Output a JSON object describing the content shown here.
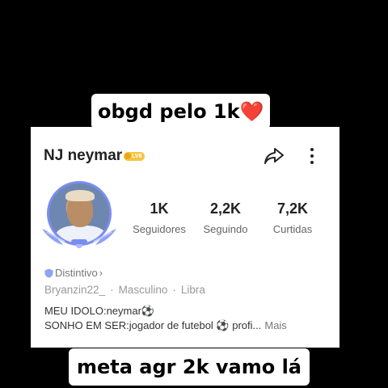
{
  "captions": {
    "top": "obgd pelo 1k",
    "top_emoji": "❤️",
    "bottom": "meta agr 2k vamo lá"
  },
  "profile": {
    "username": "NJ neymar",
    "level_badge": "LV6",
    "icons": {
      "share": "share-arrow-icon",
      "more": "more-vertical-icon",
      "badge": "shield-icon"
    },
    "stats": [
      {
        "value": "1K",
        "label": "Seguidores"
      },
      {
        "value": "2,2K",
        "label": "Seguindo"
      },
      {
        "value": "7,2K",
        "label": "Curtidas"
      }
    ],
    "distintivo": "Distintivo",
    "distintivo_chevron": "›",
    "handle": "Bryanzin22_",
    "gender": "Masculino",
    "sign": "Libra",
    "separator": "·",
    "bio_line1": "MEU IDOLO:neymar⚽",
    "bio_line2": "SONHO EM SER:jogador de futebol ⚽ profi...",
    "more_label": "Mais"
  },
  "colors": {
    "background": "#000000",
    "card": "#ffffff",
    "heart": "#e8192c",
    "avatar_ring": "#7b8cf0",
    "level_badge": "#f4c542"
  }
}
